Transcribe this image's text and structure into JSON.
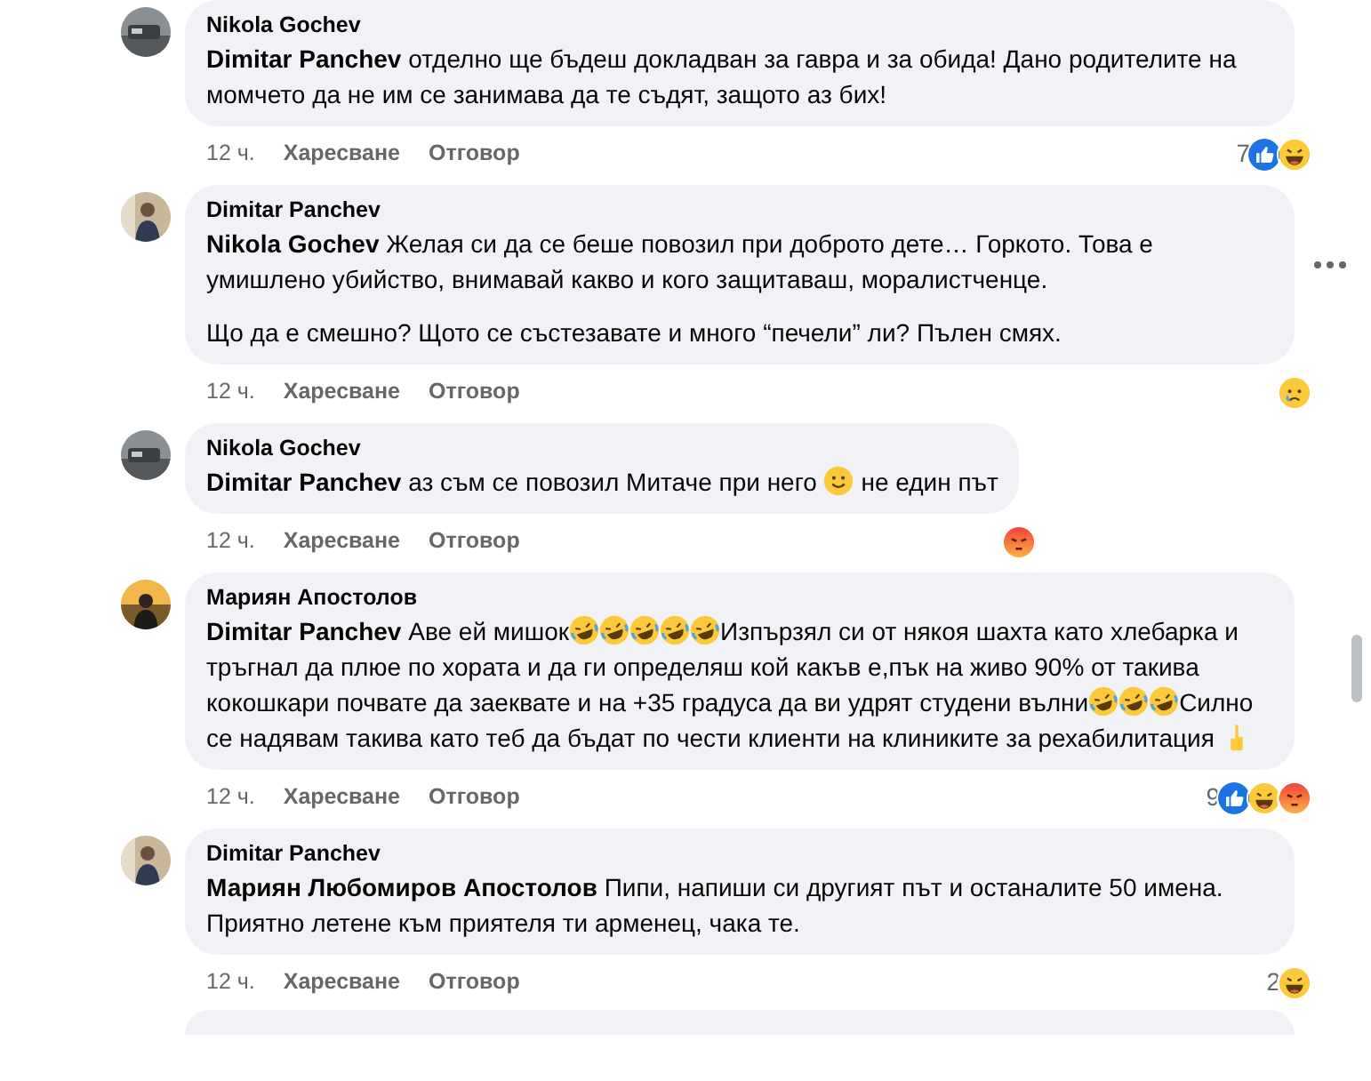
{
  "comments": [
    {
      "kind": "comment",
      "author": "Nikola Gochev",
      "paragraphs": [
        [
          {
            "kind": "text",
            "text": "**Dimitar Panchev** отделно ще бъдеш докладван за гавра и за обида! Дано родителите на момчето да не им се занимава да те съдят, защото аз бих!"
          }
        ]
      ],
      "time": "12 ч.",
      "like_label": "Харесване",
      "reply_label": "Отговор",
      "reaction_count": "7",
      "reactions": [
        {
          "kind": "like"
        },
        {
          "kind": "haha"
        }
      ]
    },
    {
      "kind": "comment",
      "author": "Dimitar Panchev",
      "has_menu": true,
      "paragraphs": [
        [
          {
            "kind": "text",
            "text": "**Nikola Gochev** Желая си да се беше повозил при доброто дете… Горкото. Това е умишлено убийство, внимавай какво и кого защитаваш, моралистченце."
          }
        ],
        [
          {
            "kind": "text",
            "text": "Що да е смешно? Щото се състезавате и много “печели” ли? Пълен смях."
          }
        ]
      ],
      "time": "12 ч.",
      "like_label": "Харесване",
      "reply_label": "Отговор",
      "reactions": [
        {
          "kind": "sad"
        }
      ]
    },
    {
      "kind": "comment",
      "author": "Nikola Gochev",
      "paragraphs": [
        [
          {
            "kind": "text",
            "text": "**Dimitar Panchev** аз съм се повозил Митаче при него "
          },
          {
            "kind": "smile"
          },
          {
            "kind": "text",
            "text": " не един път"
          }
        ]
      ],
      "time": "12 ч.",
      "like_label": "Харесване",
      "reply_label": "Отговор",
      "reactions": [
        {
          "kind": "angry"
        }
      ]
    },
    {
      "kind": "comment",
      "author": "Мариян Апостолов",
      "paragraphs": [
        [
          {
            "kind": "text",
            "text": "**Dimitar Panchev** Аве ей мишок"
          },
          {
            "kind": "laugh"
          },
          {
            "kind": "laugh"
          },
          {
            "kind": "laugh"
          },
          {
            "kind": "laugh"
          },
          {
            "kind": "laugh"
          },
          {
            "kind": "text",
            "text": "Изпързял си от някоя шахта като хлебарка и тръгнал да плюе по хората и да ги определяш кой какъв е,пък на живо 90% от такива кокошкари почвате да заеквате и на +35 градуса да ви удрят студени вълни"
          },
          {
            "kind": "laugh"
          },
          {
            "kind": "laugh"
          },
          {
            "kind": "laugh"
          },
          {
            "kind": "text",
            "text": "Силно се надявам такива като теб да бъдат по чести клиенти на клиниките за рехабилитация "
          },
          {
            "kind": "finger"
          }
        ]
      ],
      "time": "12 ч.",
      "like_label": "Харесване",
      "reply_label": "Отговор",
      "reaction_count": "9",
      "reactions": [
        {
          "kind": "like"
        },
        {
          "kind": "haha"
        },
        {
          "kind": "angry"
        }
      ]
    },
    {
      "kind": "comment",
      "author": "Dimitar Panchev",
      "paragraphs": [
        [
          {
            "kind": "text",
            "text": "**Мариян Любомиров Апостолов** Пипи, напиши си другият път и останалите 50 имена. Приятно летене към приятеля ти арменец, чака те."
          }
        ]
      ],
      "time": "12 ч.",
      "like_label": "Харесване",
      "reply_label": "Отговор",
      "reaction_count": "2",
      "reactions": [
        {
          "kind": "haha"
        }
      ]
    },
    {
      "kind": "partial"
    }
  ]
}
